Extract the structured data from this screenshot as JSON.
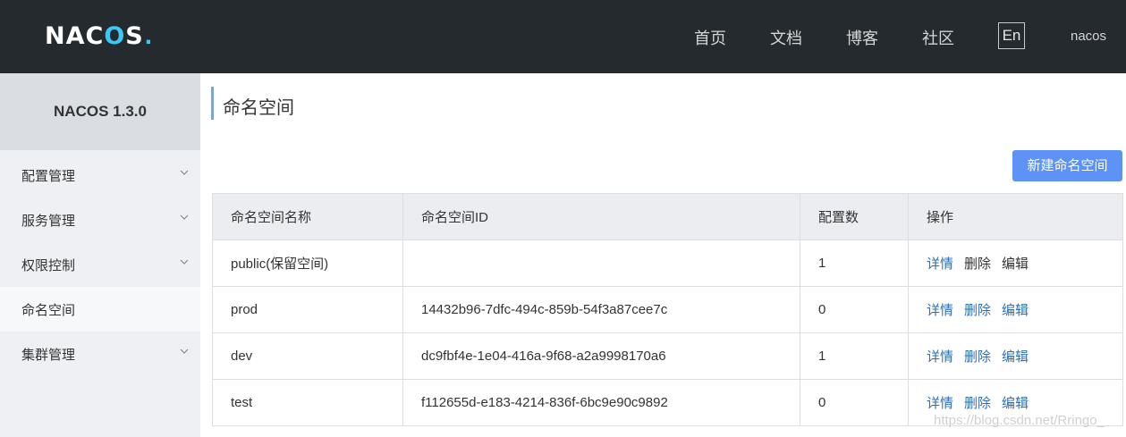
{
  "header": {
    "logo_text_a": "NAC",
    "logo_text_o": "O",
    "logo_text_b": "S",
    "nav": [
      "首页",
      "文档",
      "博客",
      "社区"
    ],
    "lang": "En",
    "user": "nacos"
  },
  "sidebar": {
    "title": "NACOS 1.3.0",
    "items": [
      {
        "label": "配置管理"
      },
      {
        "label": "服务管理"
      },
      {
        "label": "权限控制"
      },
      {
        "label": "命名空间"
      },
      {
        "label": "集群管理"
      }
    ]
  },
  "main": {
    "title": "命名空间",
    "new_button": "新建命名空间",
    "table": {
      "headers": [
        "命名空间名称",
        "命名空间ID",
        "配置数",
        "操作"
      ],
      "rows": [
        {
          "name": "public(保留空间)",
          "id": "",
          "count": "1",
          "ops": [
            "详情",
            "删除",
            "编辑"
          ]
        },
        {
          "name": "prod",
          "id": "14432b96-7dfc-494c-859b-54f3a87cee7c",
          "count": "0",
          "ops": [
            "详情",
            "删除",
            "编辑"
          ]
        },
        {
          "name": "dev",
          "id": "dc9fbf4e-1e04-416a-9f68-a2a9998170a6",
          "count": "1",
          "ops": [
            "详情",
            "删除",
            "编辑"
          ]
        },
        {
          "name": "test",
          "id": "f112655d-e183-4214-836f-6bc9e90c9892",
          "count": "0",
          "ops": [
            "详情",
            "删除",
            "编辑"
          ]
        }
      ]
    }
  },
  "watermark": "https://blog.csdn.net/Rringo_",
  "colors": {
    "header_bg": "#252a2f",
    "accent": "#3ec7f0",
    "primary_button": "#5e92f5",
    "link": "#2d6fb6"
  }
}
